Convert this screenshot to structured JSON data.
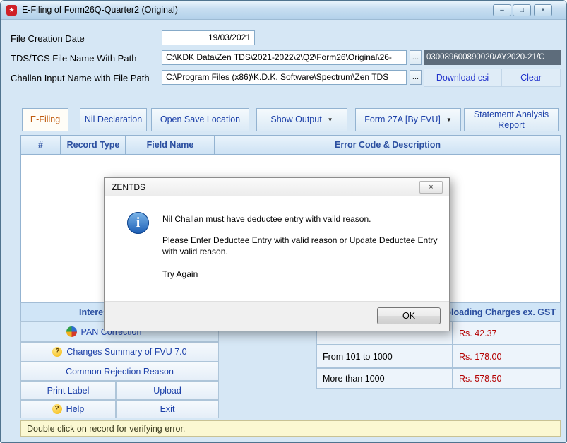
{
  "window": {
    "title": "E-Filing of Form26Q-Quarter2 (Original)"
  },
  "icons": {
    "app_logo": "★",
    "minimize": "–",
    "restore": "□",
    "close": "×",
    "dropdown": "▼",
    "browse": "...",
    "help_badge": "?",
    "info": "i"
  },
  "form": {
    "file_creation_date_label": "File Creation Date",
    "file_creation_date_value": "19/03/2021",
    "tds_path_label": "TDS/TCS File Name With Path",
    "tds_path_value": "C:\\KDK Data\\Zen TDS\\2021-2022\\2\\Q2\\Form26\\Original\\26-",
    "tds_path_suffix": "030089600890020/AY2020-21/C",
    "challan_path_label": "Challan Input Name with File Path",
    "challan_path_value": "C:\\Program Files (x86)\\K.D.K. Software\\Spectrum\\Zen TDS",
    "download_csi_label": "Download csi",
    "clear_label": "Clear"
  },
  "tabs": [
    {
      "label": "E-Filing"
    },
    {
      "label": "Nil Declaration"
    },
    {
      "label": "Open Save Location"
    },
    {
      "label": "Show Output"
    },
    {
      "label": "Form 27A [By FVU]"
    },
    {
      "label": "Statement Analysis Report"
    }
  ],
  "error_table": {
    "columns": [
      "#",
      "Record Type",
      "Field Name",
      "Error Code & Description"
    ]
  },
  "section_headers": {
    "interest": "Interest Calculation",
    "uploading_charges": "Uploading Charges ex. GST"
  },
  "left_actions": {
    "pan_correction": "PAN Correction",
    "changes_summary": "Changes Summary of FVU 7.0",
    "common_rejection": "Common Rejection Reason",
    "print_label": "Print Label",
    "upload": "Upload",
    "help": "Help",
    "exit": "Exit"
  },
  "charges_table": {
    "rows": [
      {
        "label": "",
        "amount": "Rs. 42.37"
      },
      {
        "label": "From 101 to 1000",
        "amount": "Rs. 178.00"
      },
      {
        "label": "More than 1000",
        "amount": "Rs. 578.50"
      }
    ]
  },
  "dialog": {
    "title": "ZENTDS",
    "message_lines": [
      "Nil Challan must have deductee entry with valid reason.",
      "Please Enter Deductee Entry with valid reason or Update Deductee Entry with valid reason.",
      "Try Again"
    ],
    "ok_label": "OK"
  },
  "status_bar": "Double click on record for verifying error.",
  "colors": {
    "accent_blue": "#1b3fa8",
    "active_tab_text": "#c05c10",
    "amount_red": "#b40000"
  }
}
